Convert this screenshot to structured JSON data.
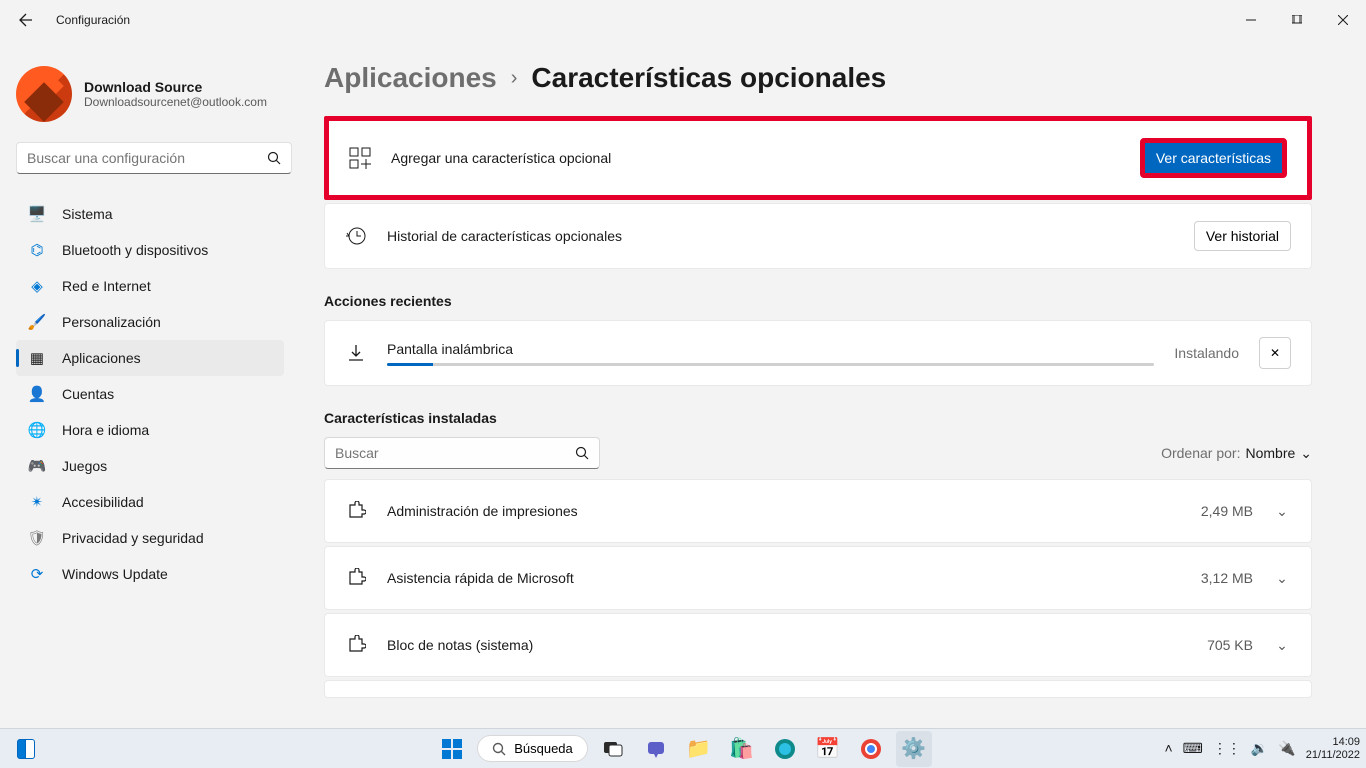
{
  "titlebar": {
    "title": "Configuración"
  },
  "profile": {
    "name": "Download Source",
    "email": "Downloadsourcenet@outlook.com"
  },
  "search": {
    "placeholder": "Buscar una configuración"
  },
  "sidebar": {
    "items": [
      {
        "label": "Sistema",
        "icon": "💻"
      },
      {
        "label": "Bluetooth y dispositivos",
        "icon": "bt"
      },
      {
        "label": "Red e Internet",
        "icon": "📶"
      },
      {
        "label": "Personalización",
        "icon": "🖌️"
      },
      {
        "label": "Aplicaciones",
        "icon": "▦"
      },
      {
        "label": "Cuentas",
        "icon": "👤"
      },
      {
        "label": "Hora e idioma",
        "icon": "🌐"
      },
      {
        "label": "Juegos",
        "icon": "🎮"
      },
      {
        "label": "Accesibilidad",
        "icon": "♿"
      },
      {
        "label": "Privacidad y seguridad",
        "icon": "🛡️"
      },
      {
        "label": "Windows Update",
        "icon": "🔄"
      }
    ]
  },
  "breadcrumb": {
    "parent": "Aplicaciones",
    "current": "Características opcionales"
  },
  "add_card": {
    "label": "Agregar una característica opcional",
    "button": "Ver características"
  },
  "history_card": {
    "label": "Historial de características opcionales",
    "button": "Ver historial"
  },
  "recent_section": {
    "title": "Acciones recientes"
  },
  "progress": {
    "name": "Pantalla inalámbrica",
    "status": "Instalando"
  },
  "installed_section": {
    "title": "Características instaladas"
  },
  "filter": {
    "placeholder": "Buscar",
    "sort_label": "Ordenar por:",
    "sort_value": "Nombre"
  },
  "features": [
    {
      "name": "Administración de impresiones",
      "size": "2,49 MB"
    },
    {
      "name": "Asistencia rápida de Microsoft",
      "size": "3,12 MB"
    },
    {
      "name": "Bloc de notas (sistema)",
      "size": "705 KB"
    }
  ],
  "taskbar": {
    "search": "Búsqueda"
  },
  "clock": {
    "time": "14:09",
    "date": "21/11/2022"
  }
}
